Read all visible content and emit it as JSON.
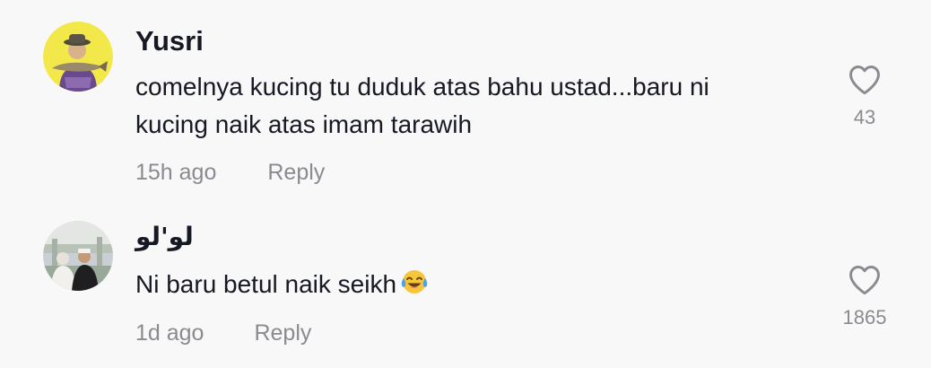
{
  "comments": [
    {
      "username": "Yusri",
      "avatar": "avatar-fisherman",
      "text_lines": [
        "comelnya kucing tu duduk atas bahu ustad...baru ni",
        "kucing naik atas imam tarawih"
      ],
      "time": "15h ago",
      "reply_label": "Reply",
      "like_count": "43"
    },
    {
      "username": "لو'لو",
      "avatar": "avatar-mosque-photo",
      "text": "Ni baru betul naik seikh",
      "emoji": "face-with-tears-of-joy",
      "time": "1d ago",
      "reply_label": "Reply",
      "like_count": "1865"
    }
  ],
  "colors": {
    "background": "#f8f8f8",
    "text_primary": "#161823",
    "text_secondary": "#8a8b91",
    "heart_outline": "#8a8b91"
  },
  "icons": {
    "like": "heart-outline-icon",
    "emoji": "face-with-tears-of-joy-emoji"
  }
}
